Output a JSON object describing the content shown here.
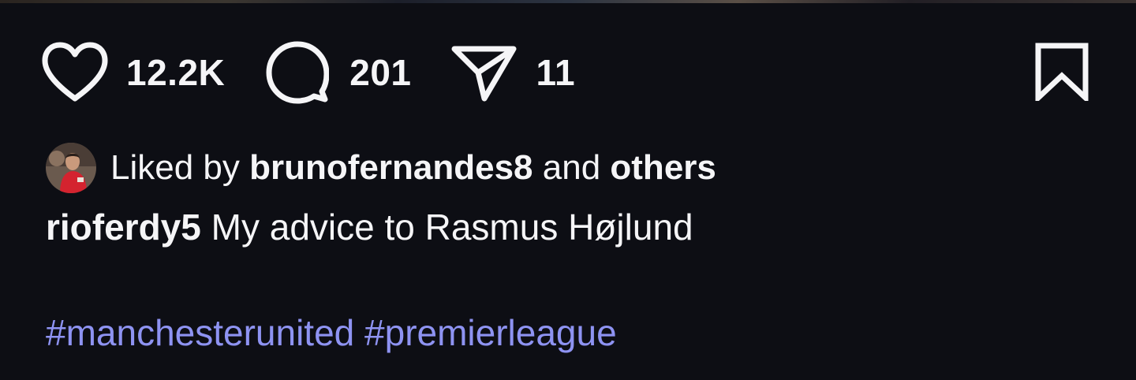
{
  "post": {
    "actions": {
      "likes": "12.2K",
      "comments": "201",
      "shares": "11"
    },
    "liked_by": {
      "prefix": "Liked by",
      "user": "brunofernandes8",
      "connector": "and",
      "others": "others"
    },
    "caption": {
      "username": "rioferdy5",
      "text": "My advice to Rasmus Højlund"
    },
    "hashtags": [
      "#manchesterunited",
      "#premierleague"
    ]
  },
  "icons": {
    "like": "heart-icon",
    "comment": "comment-bubble-icon",
    "share": "paper-plane-icon",
    "save": "bookmark-icon"
  },
  "colors": {
    "background": "#0d0e14",
    "text": "#f5f5f7",
    "hashtag": "#8e93f2"
  }
}
